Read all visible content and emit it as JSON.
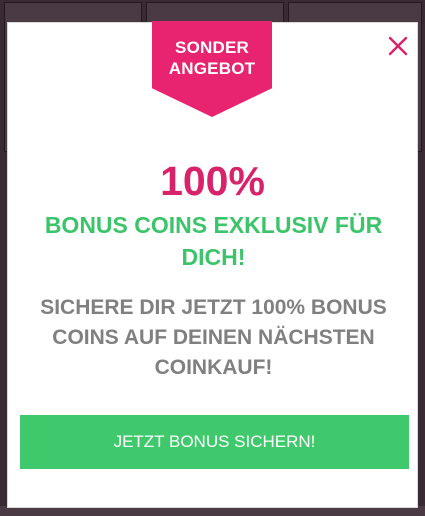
{
  "ribbon": {
    "line1": "SONDER",
    "line2": "ANGEBOT"
  },
  "offer": {
    "percent": "100%",
    "headline": "BONUS COINS EXKLUSIV FÜR DICH!",
    "subtext": "SICHERE DIR JETZT 100% BONUS COINS AUF DEINEN NÄCHSTEN COINKAUF!",
    "cta_label": "JETZT BONUS SICHERN!"
  },
  "icons": {
    "close": "close-icon"
  },
  "colors": {
    "accent_pink": "#e8236f",
    "headline_pink": "#d8226a",
    "green": "#3cc46a",
    "button_green": "#3fc86c",
    "text_gray": "#808080"
  }
}
